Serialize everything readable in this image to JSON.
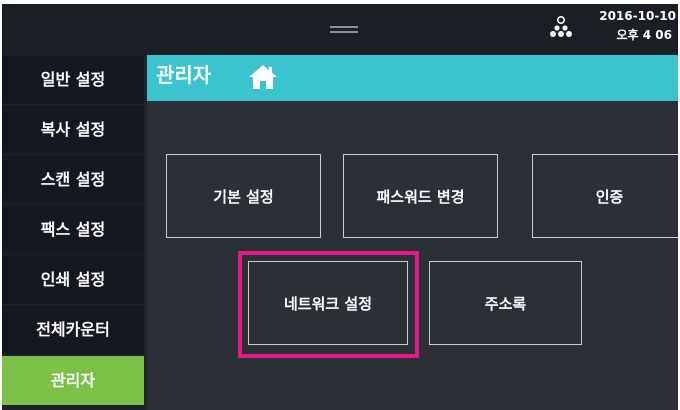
{
  "status": {
    "date": "2016-10-10",
    "time": "오후 4  06"
  },
  "icons": {
    "handle": "drag-handle-icon",
    "network": "network-icon",
    "home": "home-icon"
  },
  "colors": {
    "title_bar": "#3cc4ce",
    "active_tab": "#7bc147",
    "highlight": "#e6198a"
  },
  "sidebar": {
    "items": [
      {
        "label": "일반 설정",
        "active": false
      },
      {
        "label": "복사 설정",
        "active": false
      },
      {
        "label": "스캔 설정",
        "active": false
      },
      {
        "label": "팩스 설정",
        "active": false
      },
      {
        "label": "인쇄 설정",
        "active": false
      },
      {
        "label": "전체카운터",
        "active": false
      },
      {
        "label": "관리자",
        "active": true
      }
    ]
  },
  "main": {
    "title": "관리자",
    "buttons": [
      {
        "label": "기본 설정"
      },
      {
        "label": "패스워드 변경"
      },
      {
        "label": "인증"
      },
      {
        "label": "네트워크 설정",
        "highlighted": true
      },
      {
        "label": "주소록"
      }
    ]
  }
}
